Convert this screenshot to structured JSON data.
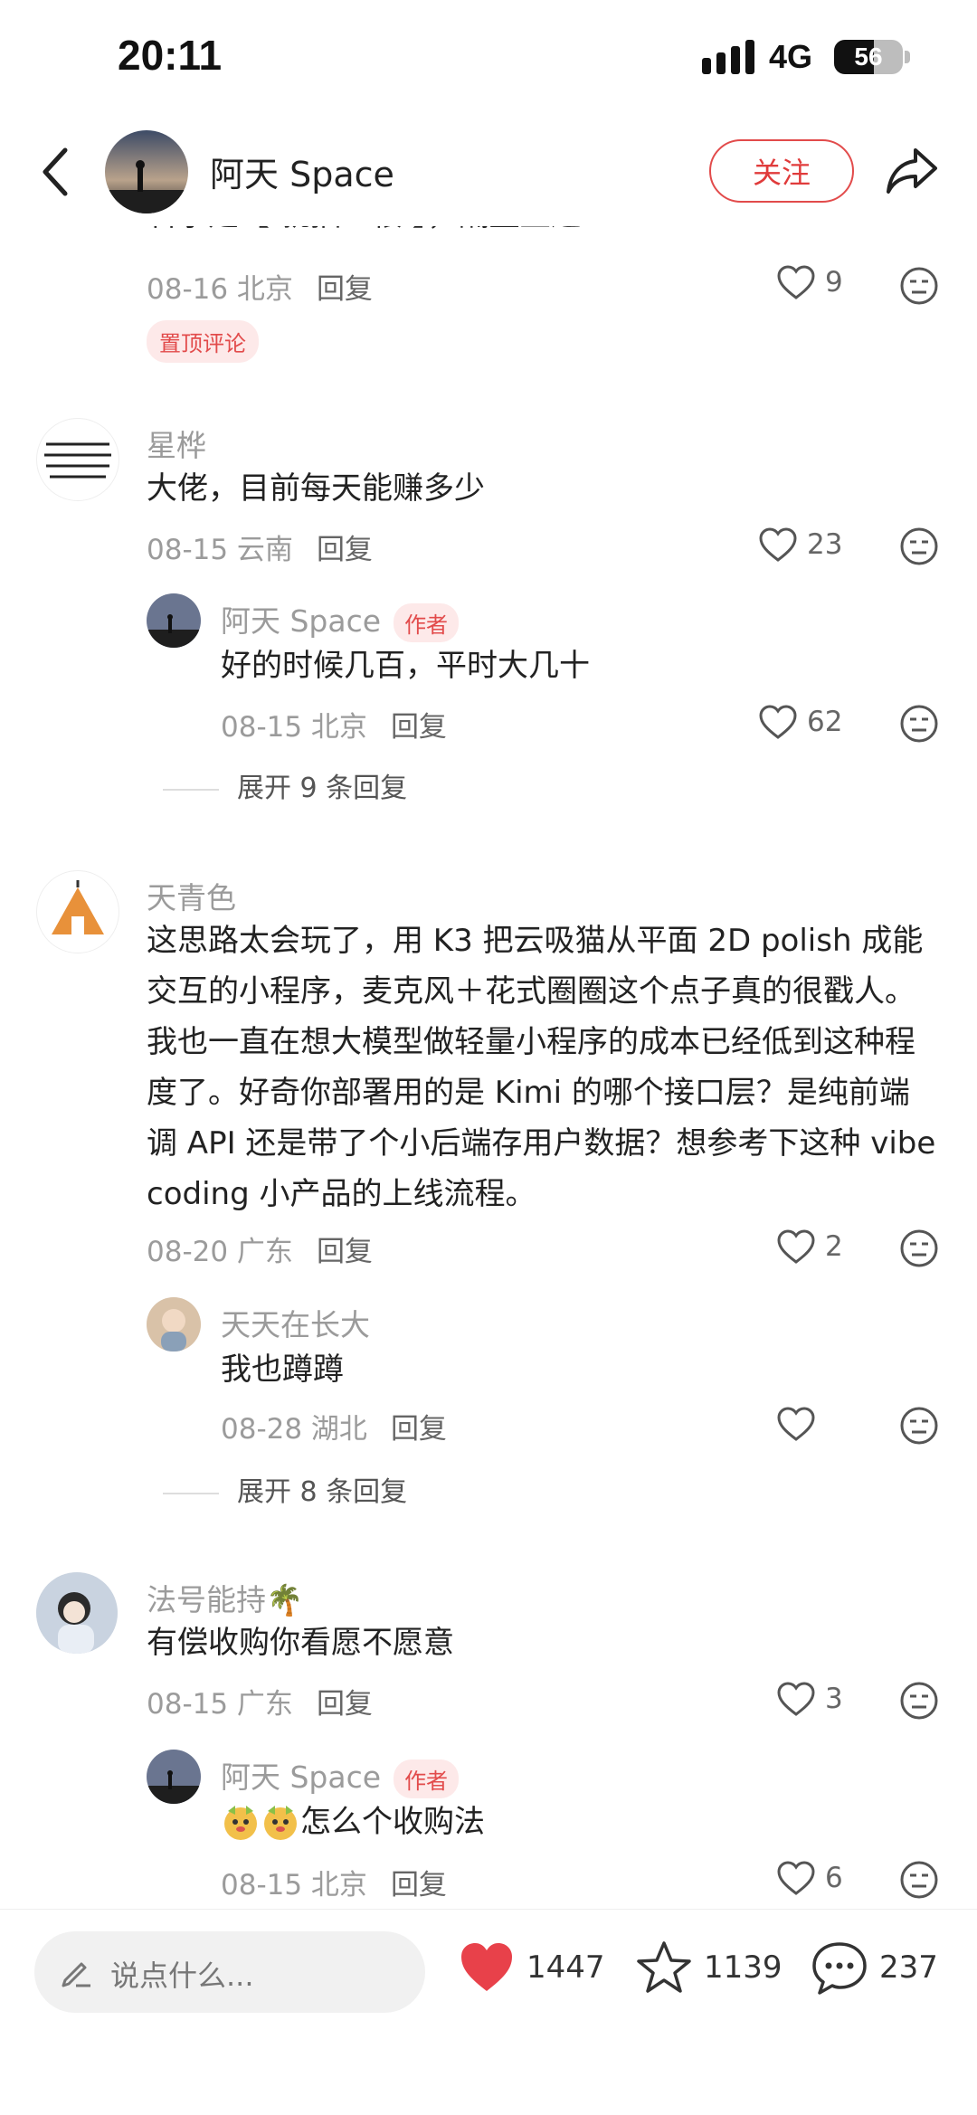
{
  "status_bar": {
    "time": "20:11",
    "network": "4G",
    "battery": "56"
  },
  "header": {
    "title": "阿天 Space",
    "follow_label": "关注"
  },
  "top_partial": {
    "text": "名字是【 就抽一根 】，隔壁直达",
    "date": "08-16 北京",
    "reply_label": "回复",
    "likes": "9",
    "pinned_label": "置顶评论"
  },
  "comments": [
    {
      "nick": "星桦",
      "text": "大佬，目前每天能赚多少",
      "date": "08-15 云南",
      "reply_label": "回复",
      "likes": "23",
      "reply": {
        "nick": "阿天 Space",
        "tag": "作者",
        "text": "好的时候几百，平时大几十",
        "date": "08-15 北京",
        "reply_label": "回复",
        "likes": "62"
      },
      "expand": "展开 9 条回复"
    },
    {
      "nick": "天青色",
      "text_lines": [
        "这思路太会玩了，用 K3 把云吸猫从平面 2D polish 成能",
        "交互的小程序，麦克风＋花式圈圈这个点子真的很戳人。",
        "我也一直在想大模型做轻量小程序的成本已经低到这种程",
        "度了。好奇你部署用的是 Kimi 的哪个接口层？是纯前端",
        "调 API 还是带了个小后端存用户数据？想参考下这种 vibe",
        "coding 小产品的上线流程。"
      ],
      "date": "08-20 广东",
      "reply_label": "回复",
      "likes": "2",
      "reply": {
        "nick": "天天在长大",
        "text": "我也蹲蹲",
        "date": "08-28 湖北",
        "reply_label": "回复",
        "likes": ""
      },
      "expand": "展开 8 条回复"
    },
    {
      "nick": "法号能持",
      "nick_emoji": "🌴",
      "text": "有偿收购你看愿不愿意",
      "date": "08-15 广东",
      "reply_label": "回复",
      "likes": "3",
      "reply": {
        "nick": "阿天 Space",
        "tag": "作者",
        "text": "怎么个收购法",
        "date": "08-15 北京",
        "reply_label": "回复",
        "likes": "6"
      }
    }
  ],
  "bottom_bar": {
    "input_placeholder": "说点什么...",
    "likes": "1447",
    "favorites": "1139",
    "comments": "237"
  },
  "colors": {
    "accent": "#e24b4b",
    "text": "#222222",
    "muted": "#9b9b9b"
  }
}
